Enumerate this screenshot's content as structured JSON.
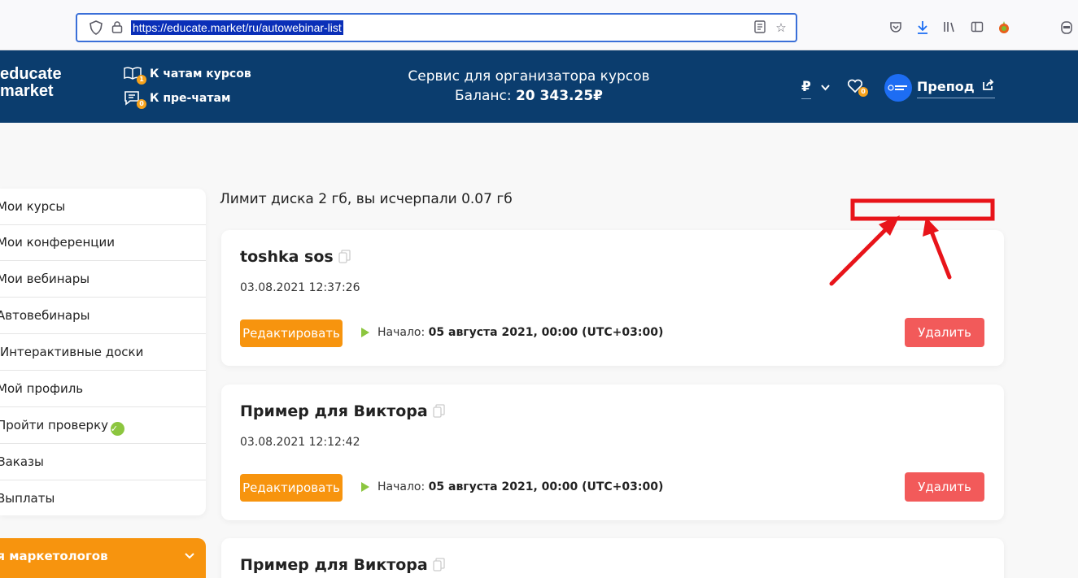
{
  "browser": {
    "url": "https://educate.market/ru/autowebinar-list"
  },
  "header": {
    "logo_line1": "educate",
    "logo_line2": "market",
    "chats_link": "К чатам курсов",
    "chats_badge": "1",
    "prechats_link": "К пре-чатам",
    "prechats_badge": "0",
    "service_title": "Сервис для организатора курсов",
    "balance_label": "Баланс: ",
    "balance_value": "20 343.25₽",
    "currency": "₽",
    "favorites_badge": "0",
    "user_name": "Препод"
  },
  "sidebar": {
    "items": [
      {
        "label": "Мои курсы"
      },
      {
        "label": "Мои конференции"
      },
      {
        "label": "Мои вебинары"
      },
      {
        "label": "Автовебинары"
      },
      {
        "label": "Интерактивные доски"
      },
      {
        "label": "Мой профиль"
      },
      {
        "label": "Пройти проверку"
      },
      {
        "label": "Заказы"
      },
      {
        "label": "Выплаты"
      }
    ],
    "marketing_label": "Для маркетологов"
  },
  "main": {
    "disk_limit": "Лимит диска 2 гб, вы исчерпали 0.07 гб",
    "cards": [
      {
        "title": "toshka sos",
        "date": "03.08.2021 12:37:26",
        "edit_label": "Редактировать",
        "start_label": "Начало: ",
        "start_value": "05 августа 2021, 00:00 (UTC+03:00)",
        "delete_label": "Удалить"
      },
      {
        "title": "Пример для Виктора",
        "date": "03.08.2021 12:12:42",
        "edit_label": "Редактировать",
        "start_label": "Начало: ",
        "start_value": "05 августа 2021, 00:00 (UTC+03:00)",
        "delete_label": "Удалить"
      },
      {
        "title": "Пример для Виктора"
      }
    ]
  },
  "colors": {
    "header_bg": "#0b3d6e",
    "accent_orange": "#f7940e",
    "delete_red": "#f25a5a",
    "annotation_red": "#e8141a",
    "check_green": "#8cc63f"
  }
}
